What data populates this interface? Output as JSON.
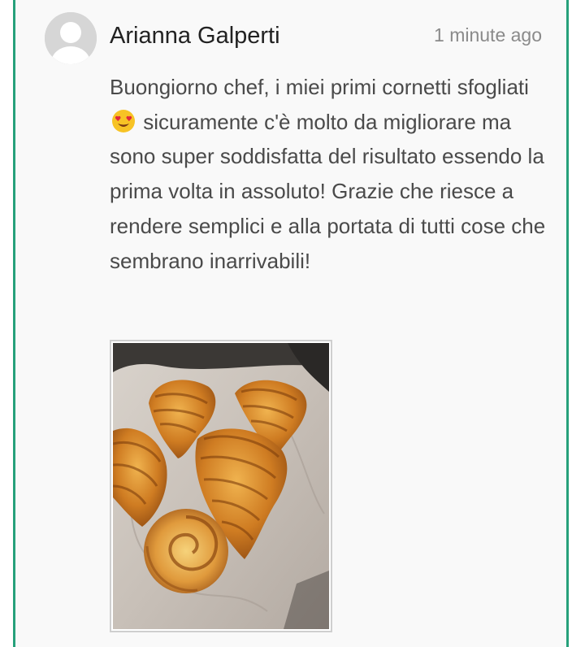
{
  "comment": {
    "author": "Arianna Galperti",
    "timestamp": "1 minute ago",
    "text_before_emoji": "Buongiorno chef, i miei primi cornetti sfogliati ",
    "emoji": "smiling-face-with-heart-eyes",
    "text_after_emoji": " sicuramente c'è molto da migliorare ma sono super soddisfatta del risultato essendo la prima volta in assoluto! Grazie che riesce a rendere semplici e alla portata di tutti cose che sembrano inarrivabili!",
    "attachment": "photo of homemade croissants on a baking tray"
  },
  "colors": {
    "accent_border": "#26a17b",
    "card_background": "#f9f9f9",
    "author_text": "#222222",
    "timestamp_text": "#8a8a8a",
    "body_text": "#4a4a4a"
  }
}
